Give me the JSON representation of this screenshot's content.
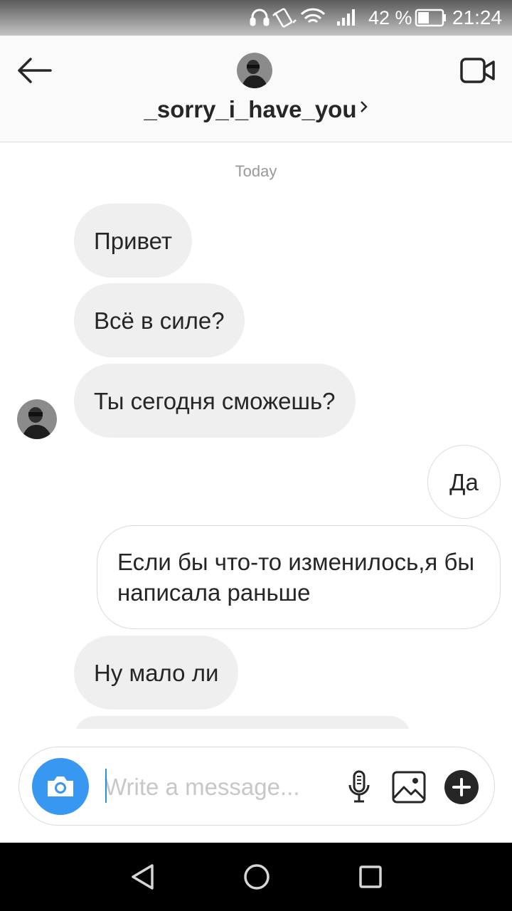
{
  "status_bar": {
    "battery_percent": "42 %",
    "time": "21:24",
    "icons": [
      "headphones-icon",
      "vibrate-icon",
      "wifi-icon",
      "signal-icon",
      "battery-icon"
    ]
  },
  "header": {
    "username": "_sorry_i_have_you",
    "icons": [
      "back-arrow-icon",
      "avatar",
      "chevron-right-icon",
      "video-call-icon"
    ]
  },
  "conversation": {
    "date_separator": "Today",
    "messages": [
      {
        "from": "them",
        "text": "Привет"
      },
      {
        "from": "them",
        "text": "Всё в силе?"
      },
      {
        "from": "them",
        "text": "Ты сегодня сможешь?"
      },
      {
        "from": "me",
        "text": "Да"
      },
      {
        "from": "me",
        "text": "Если бы что-то изменилось,я бы написала раньше"
      },
      {
        "from": "them",
        "text": "Ну мало ли"
      }
    ]
  },
  "composer": {
    "placeholder": "Write a message...",
    "value": "",
    "icons": [
      "camera-icon",
      "microphone-icon",
      "gallery-icon",
      "plus-icon"
    ]
  },
  "nav_bar": {
    "icons": [
      "nav-back-icon",
      "nav-home-icon",
      "nav-recents-icon"
    ]
  },
  "colors": {
    "accent": "#3897f0",
    "incoming_bubble": "#efefef",
    "outgoing_border": "#dbdbdb",
    "text": "#262626",
    "muted": "#999999"
  }
}
